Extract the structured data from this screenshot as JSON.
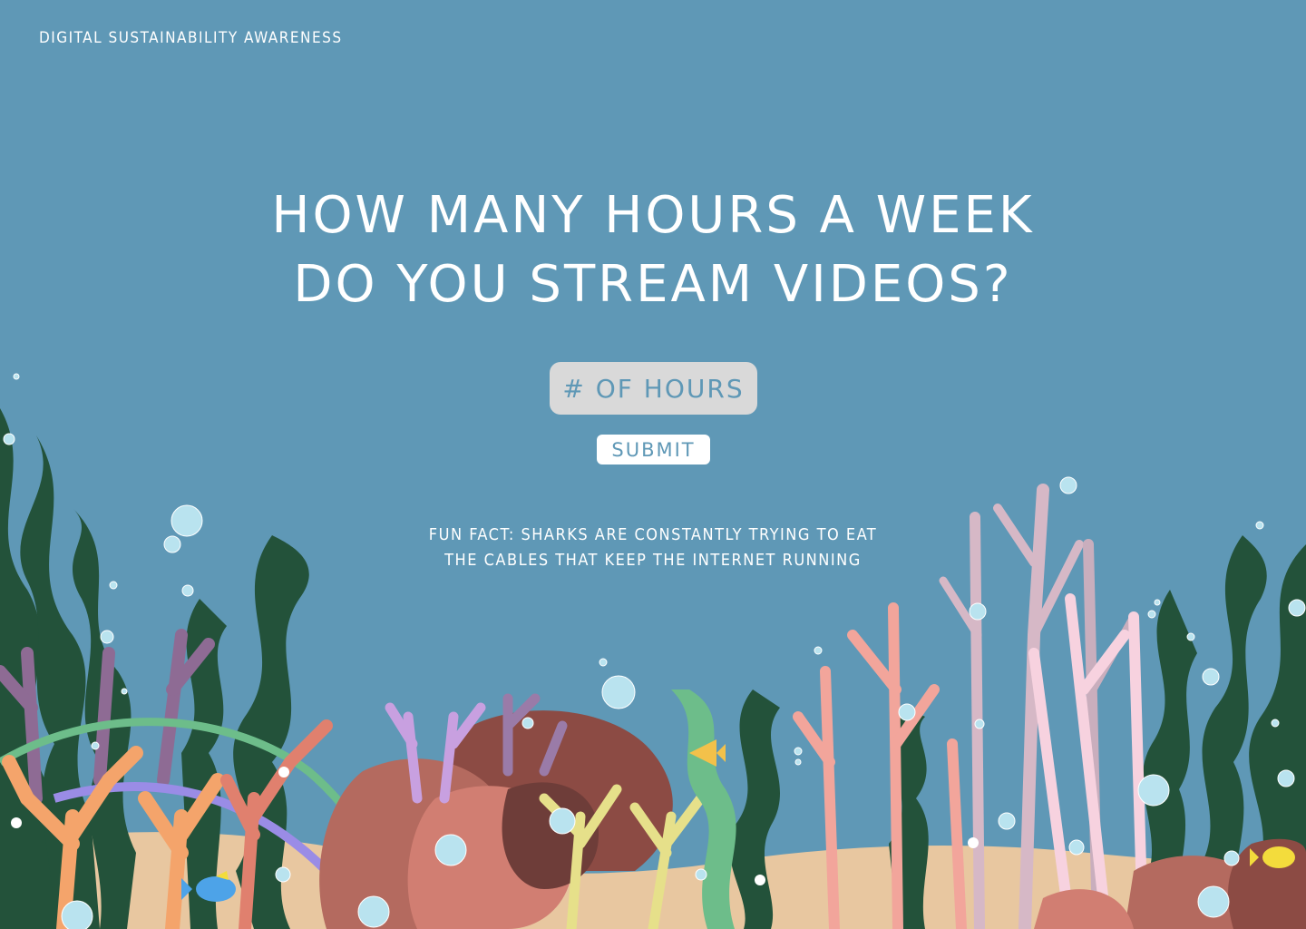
{
  "brand": "Digital Sustainability Awareness",
  "question": {
    "line1": "How many hours a week",
    "line2": "do you stream videos?"
  },
  "hours_input": {
    "placeholder": "# of hours",
    "value": ""
  },
  "submit_label": "SUBMIT",
  "fun_fact": {
    "line1": "Fun Fact: Sharks are constantly trying to eat",
    "line2": "the cables that keep the internet running"
  },
  "colors": {
    "background": "#5f98b6",
    "text": "#ffffff",
    "input_bg": "#d9d9d9",
    "seaweed_dark": "#23523a",
    "coral_orange": "#f4a46b",
    "coral_pink": "#f2a59b",
    "coral_purple": "#c8a0e0",
    "rock_brown": "#8c4b44"
  },
  "illustration": {
    "elements": [
      "seaweed",
      "coral",
      "rocks",
      "bubbles",
      "fish"
    ]
  }
}
